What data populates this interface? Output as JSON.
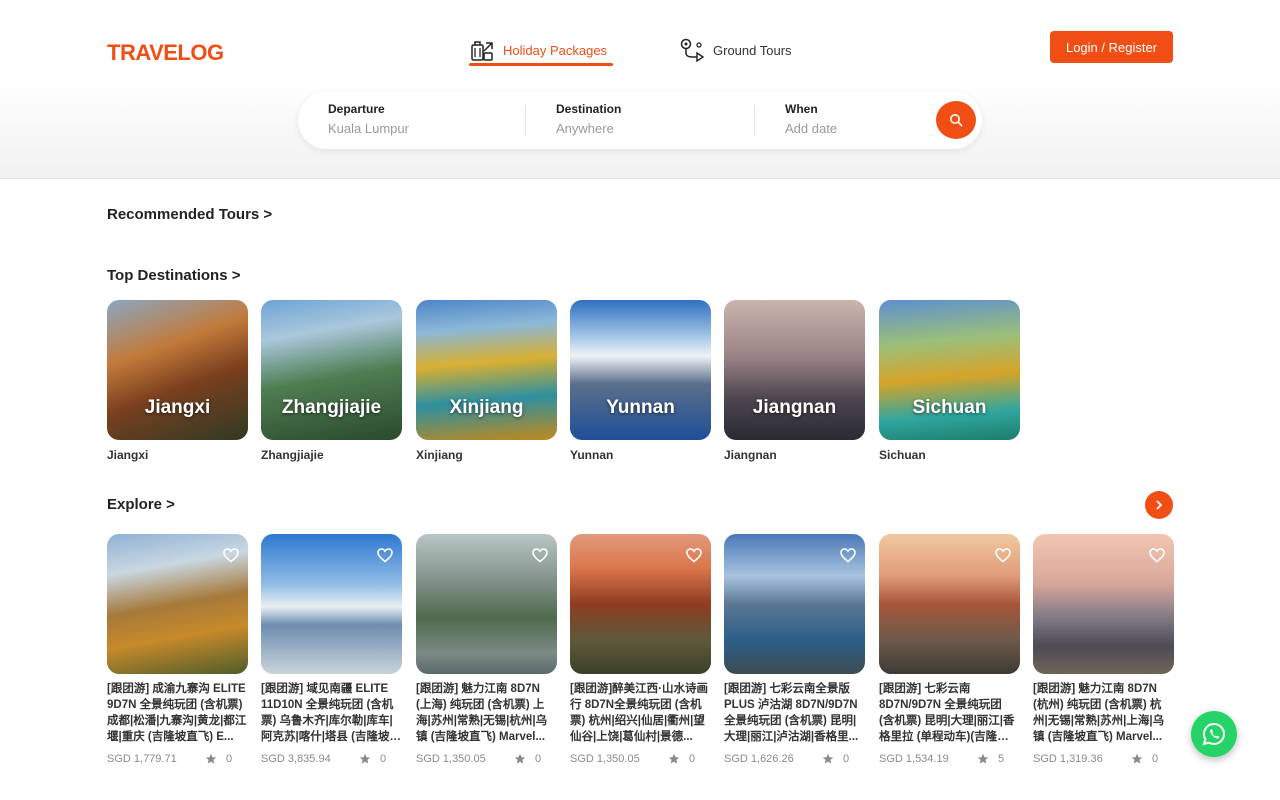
{
  "brand": {
    "logo": "TRAVELOG",
    "accent": "#f04e14"
  },
  "nav": {
    "tabs": [
      {
        "label": "Holiday Packages",
        "icon": "luggage-icon",
        "active": true
      },
      {
        "label": "Ground Tours",
        "icon": "route-map-icon",
        "active": false
      }
    ],
    "login_label": "Login / Register"
  },
  "search": {
    "departure": {
      "label": "Departure",
      "value": "Kuala Lumpur"
    },
    "destination": {
      "label": "Destination",
      "value": "Anywhere"
    },
    "when": {
      "label": "When",
      "value": "Add date"
    },
    "button_icon": "search-icon"
  },
  "sections": {
    "recommended": "Recommended Tours >",
    "top_destinations": "Top Destinations >",
    "explore": "Explore >"
  },
  "destinations": [
    {
      "name": "Jiangxi",
      "overlay": "Jiangxi"
    },
    {
      "name": "Zhangjiajie",
      "overlay": "Zhangjiajie"
    },
    {
      "name": "Xinjiang",
      "overlay": "Xinjiang"
    },
    {
      "name": "Yunnan",
      "overlay": "Yunnan"
    },
    {
      "name": "Jiangnan",
      "overlay": "Jiangnan"
    },
    {
      "name": "Sichuan",
      "overlay": "Sichuan"
    }
  ],
  "tours": [
    {
      "title": "[跟团游] 成渝九寨沟 ELITE 9D7N 全景纯玩团 (含机票) 成都|松潘|九寨沟|黄龙|都江堰|重庆 (吉隆坡直飞) E...",
      "price": "SGD 1,779.71",
      "rating": "0"
    },
    {
      "title": "[跟团游] 域见南疆 ELITE 11D10N 全景纯玩团 (含机票) 乌鲁木齐|库尔勒|库车|阿克苏|喀什|塔县 (吉隆坡-中...",
      "price": "SGD 3,835.94",
      "rating": "0"
    },
    {
      "title": "[跟团游] 魅力江南 8D7N (上海) 纯玩团 (含机票) 上海|苏州|常熟|无锡|杭州|乌镇 (吉隆坡直飞) Marvel...",
      "price": "SGD 1,350.05",
      "rating": "0"
    },
    {
      "title": "[跟团游]醉美江西·山水诗画行 8D7N全景纯玩团 (含机票) 杭州|绍兴|仙居|衢州|望仙谷|上饶|葛仙村|景德...",
      "price": "SGD 1,350.05",
      "rating": "0"
    },
    {
      "title": "[跟团游] 七彩云南全景版PLUS 泸沽湖 8D7N/9D7N 全景纯玩团 (含机票) 昆明|大理|丽江|泸沽湖|香格里...",
      "price": "SGD 1,626.26",
      "rating": "0"
    },
    {
      "title": "[跟团游] 七彩云南 8D7N/9D7N 全景纯玩团 (含机票) 昆明|大理|丽江|香格里拉 (单程动车)(吉隆坡直飞) ...",
      "price": "SGD 1,534.19",
      "rating": "5"
    },
    {
      "title": "[跟团游] 魅力江南 8D7N (杭州) 纯玩团 (含机票) 杭州|无锡|常熟|苏州|上海|乌镇 (吉隆坡直飞) Marvel...",
      "price": "SGD 1,319.36",
      "rating": "0"
    }
  ],
  "icons": {
    "heart": "heart-outline-icon",
    "star": "star-icon",
    "next": "chevron-right-icon",
    "chat": "whatsapp-icon"
  }
}
